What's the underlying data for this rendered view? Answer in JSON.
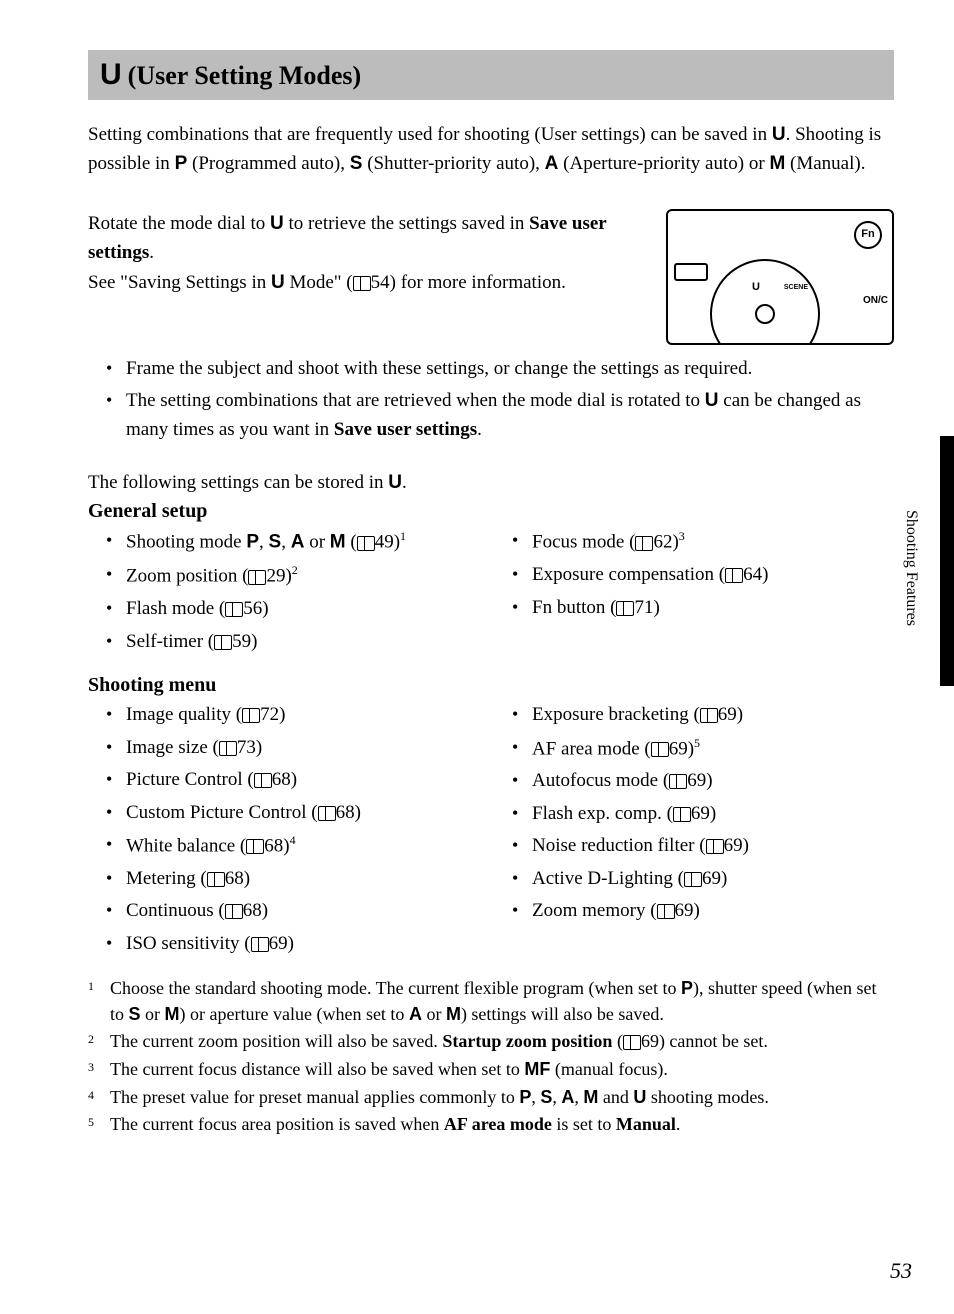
{
  "heading": {
    "icon": "U",
    "text": "(User Setting Modes)"
  },
  "intro": {
    "pre": "Setting combinations that are frequently used for shooting (User settings) can be saved in ",
    "u": "U",
    "mid1": ". Shooting is possible in ",
    "p": "P",
    "p_lbl": " (Programmed auto), ",
    "s": "S",
    "s_lbl": " (Shutter-priority auto), ",
    "a": "A",
    "a_lbl": " (Aperture-priority auto) or ",
    "m": "M",
    "m_lbl": " (Manual)."
  },
  "rotate": {
    "l1a": "Rotate the mode dial to ",
    "l1u": "U",
    "l1b": " to retrieve the settings saved in ",
    "l1c": "Save user settings",
    "l1d": ".",
    "l2a": "See \"Saving Settings in ",
    "l2u": "U",
    "l2b": " Mode\" (",
    "l2page": "54) for more information."
  },
  "illus": {
    "fn": "Fn",
    "onoff": "ON/C",
    "scene": "SCENE",
    "u": "U"
  },
  "bullets1": [
    "Frame the subject and shoot with these settings, or change the settings as required."
  ],
  "bullet2": {
    "a": "The setting combinations that are retrieved when the mode dial is rotated to ",
    "u": "U",
    "b": " can be changed as many times as you want in ",
    "c": "Save user settings",
    "d": "."
  },
  "stored_intro": {
    "a": "The following settings can be stored in ",
    "u": "U",
    "b": "."
  },
  "general": {
    "title": "General setup",
    "left": [
      {
        "pre": "Shooting mode ",
        "sym": "P",
        "mid": ", ",
        "sym2": "S",
        "mid2": ", ",
        "sym3": "A",
        "mid3": " or ",
        "sym4": "M",
        "post": " (",
        "pg": "49)",
        "sup": "1"
      },
      {
        "pre": "Zoom position (",
        "pg": "29)",
        "sup": "2"
      },
      {
        "pre": "Flash mode (",
        "pg": "56)"
      },
      {
        "pre": "Self-timer (",
        "pg": "59)"
      }
    ],
    "right": [
      {
        "pre": "Focus mode (",
        "pg": "62)",
        "sup": "3"
      },
      {
        "pre": "Exposure compensation (",
        "pg": "64)"
      },
      {
        "pre": "Fn button (",
        "pg": "71)"
      }
    ]
  },
  "shooting": {
    "title": "Shooting menu",
    "left": [
      {
        "pre": "Image quality (",
        "pg": "72)"
      },
      {
        "pre": "Image size (",
        "pg": "73)"
      },
      {
        "pre": "Picture Control (",
        "pg": "68)"
      },
      {
        "pre": "Custom Picture Control (",
        "pg": "68)"
      },
      {
        "pre": "White balance (",
        "pg": "68)",
        "sup": "4"
      },
      {
        "pre": "Metering (",
        "pg": "68)"
      },
      {
        "pre": "Continuous (",
        "pg": "68)"
      },
      {
        "pre": "ISO sensitivity (",
        "pg": "69)"
      }
    ],
    "right": [
      {
        "pre": "Exposure bracketing (",
        "pg": "69)"
      },
      {
        "pre": "AF area mode (",
        "pg": "69)",
        "sup": "5"
      },
      {
        "pre": "Autofocus mode (",
        "pg": "69)"
      },
      {
        "pre": "Flash exp. comp. (",
        "pg": "69)"
      },
      {
        "pre": "Noise reduction filter (",
        "pg": "69)"
      },
      {
        "pre": "Active D-Lighting (",
        "pg": "69)"
      },
      {
        "pre": "Zoom memory (",
        "pg": "69)"
      }
    ]
  },
  "footnotes": [
    {
      "n": "1",
      "parts": [
        {
          "t": "Choose the standard shooting mode. The current flexible program (when set to "
        },
        {
          "sym": "P"
        },
        {
          "t": "), shutter speed (when set to "
        },
        {
          "sym": "S"
        },
        {
          "t": " or "
        },
        {
          "sym": "M"
        },
        {
          "t": ") or aperture value (when set to "
        },
        {
          "sym": "A"
        },
        {
          "t": " or "
        },
        {
          "sym": "M"
        },
        {
          "t": ") settings will also be saved."
        }
      ]
    },
    {
      "n": "2",
      "parts": [
        {
          "t": "The current zoom position will also be saved. "
        },
        {
          "b": "Startup zoom position"
        },
        {
          "t": " ("
        },
        {
          "book": true
        },
        {
          "t": "69) cannot be set."
        }
      ]
    },
    {
      "n": "3",
      "parts": [
        {
          "t": "The current focus distance will also be saved when set to "
        },
        {
          "sym": "MF"
        },
        {
          "t": " (manual focus)."
        }
      ]
    },
    {
      "n": "4",
      "parts": [
        {
          "t": "The preset value for preset manual applies commonly to "
        },
        {
          "sym": "P"
        },
        {
          "t": ", "
        },
        {
          "sym": "S"
        },
        {
          "t": ", "
        },
        {
          "sym": "A"
        },
        {
          "t": ", "
        },
        {
          "sym": "M"
        },
        {
          "t": " and "
        },
        {
          "sym": "U"
        },
        {
          "t": " shooting modes."
        }
      ]
    },
    {
      "n": "5",
      "parts": [
        {
          "t": "The current focus area position is saved when "
        },
        {
          "b": "AF area mode"
        },
        {
          "t": " is set to "
        },
        {
          "b": "Manual"
        },
        {
          "t": "."
        }
      ]
    }
  ],
  "side_label": "Shooting Features",
  "page_num": "53"
}
